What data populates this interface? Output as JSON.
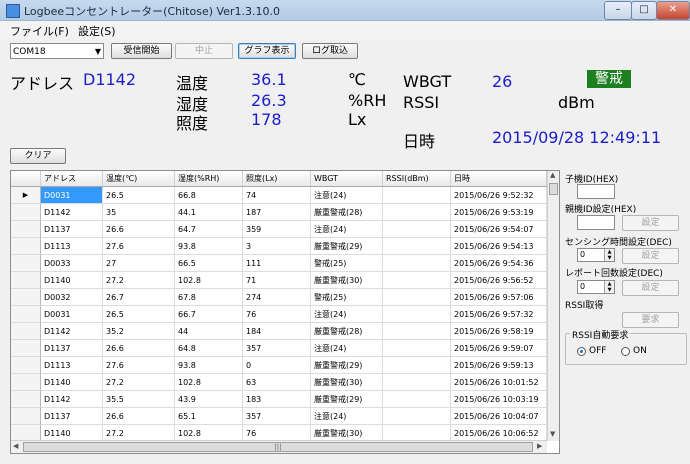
{
  "window": {
    "title": "Logbeeコンセントレーター(Chitose) Ver1.3.10.0"
  },
  "menu": [
    "ファイル(F)",
    "設定(S)"
  ],
  "toolbar": {
    "port": "COM18",
    "start_label": "受信開始",
    "stop_label": "中止",
    "graph_label": "グラフ表示",
    "log_label": "ログ取込",
    "clear_label": "クリア"
  },
  "readout": {
    "address_label": "アドレス",
    "address_value": "D1142",
    "temp_label": "温度",
    "temp_value": "36.1",
    "temp_unit": "℃",
    "hum_label": "湿度",
    "hum_value": "26.3",
    "hum_unit": "%RH",
    "lux_label": "照度",
    "lux_value": "178",
    "lux_unit": "Lx",
    "wbgt_label": "WBGT",
    "wbgt_value": "26",
    "wbgt_status": "警戒",
    "rssi_label": "RSSI",
    "rssi_unit": "dBm",
    "datetime_label": "日時",
    "datetime_value": "2015/09/28 12:49:11"
  },
  "table": {
    "columns": [
      "アドレス",
      "温度(℃)",
      "湿度(%RH)",
      "照度(Lx)",
      "WBGT",
      "RSSI(dBm)",
      "日時"
    ],
    "rows": [
      [
        "D0031",
        "26.5",
        "66.8",
        "74",
        "注意(24)",
        "",
        "2015/06/26  9:52:32"
      ],
      [
        "D1142",
        "35",
        "44.1",
        "187",
        "厳重警戒(28)",
        "",
        "2015/06/26  9:53:19"
      ],
      [
        "D1137",
        "26.6",
        "64.7",
        "359",
        "注意(24)",
        "",
        "2015/06/26  9:54:07"
      ],
      [
        "D1113",
        "27.6",
        "93.8",
        "3",
        "厳重警戒(29)",
        "",
        "2015/06/26  9:54:13"
      ],
      [
        "D0033",
        "27",
        "66.5",
        "111",
        "警戒(25)",
        "",
        "2015/06/26  9:54:36"
      ],
      [
        "D1140",
        "27.2",
        "102.8",
        "71",
        "厳重警戒(30)",
        "",
        "2015/06/26  9:56:52"
      ],
      [
        "D0032",
        "26.7",
        "67.8",
        "274",
        "警戒(25)",
        "",
        "2015/06/26  9:57:06"
      ],
      [
        "D0031",
        "26.5",
        "66.7",
        "76",
        "注意(24)",
        "",
        "2015/06/26  9:57:32"
      ],
      [
        "D1142",
        "35.2",
        "44",
        "184",
        "厳重警戒(28)",
        "",
        "2015/06/26  9:58:19"
      ],
      [
        "D1137",
        "26.6",
        "64.8",
        "357",
        "注意(24)",
        "",
        "2015/06/26  9:59:07"
      ],
      [
        "D1113",
        "27.6",
        "93.8",
        "0",
        "厳重警戒(29)",
        "",
        "2015/06/26  9:59:13"
      ],
      [
        "D1140",
        "27.2",
        "102.8",
        "63",
        "厳重警戒(30)",
        "",
        "2015/06/26  10:01:52"
      ],
      [
        "D1142",
        "35.5",
        "43.9",
        "183",
        "厳重警戒(29)",
        "",
        "2015/06/26  10:03:19"
      ],
      [
        "D1137",
        "26.6",
        "65.1",
        "357",
        "注意(24)",
        "",
        "2015/06/26  10:04:07"
      ],
      [
        "D1140",
        "27.2",
        "102.8",
        "76",
        "厳重警戒(30)",
        "",
        "2015/06/26  10:06:52"
      ]
    ]
  },
  "side": {
    "child_id_label": "子機ID(HEX)",
    "parent_id_label": "親機ID設定(HEX)",
    "set_label": "設定",
    "sensing_label": "センシング時間設定(DEC)",
    "sensing_value": "0",
    "report_label": "レポート回数設定(DEC)",
    "report_value": "0",
    "rssi_get_label": "RSSI取得",
    "request_label": "要求",
    "rssi_auto_label": "RSSI自動要求",
    "off_label": "OFF",
    "on_label": "ON"
  },
  "colors": {
    "value_blue": "#1c1cc8",
    "badge_green": "#1d7f1d",
    "selection": "#3399ff"
  }
}
